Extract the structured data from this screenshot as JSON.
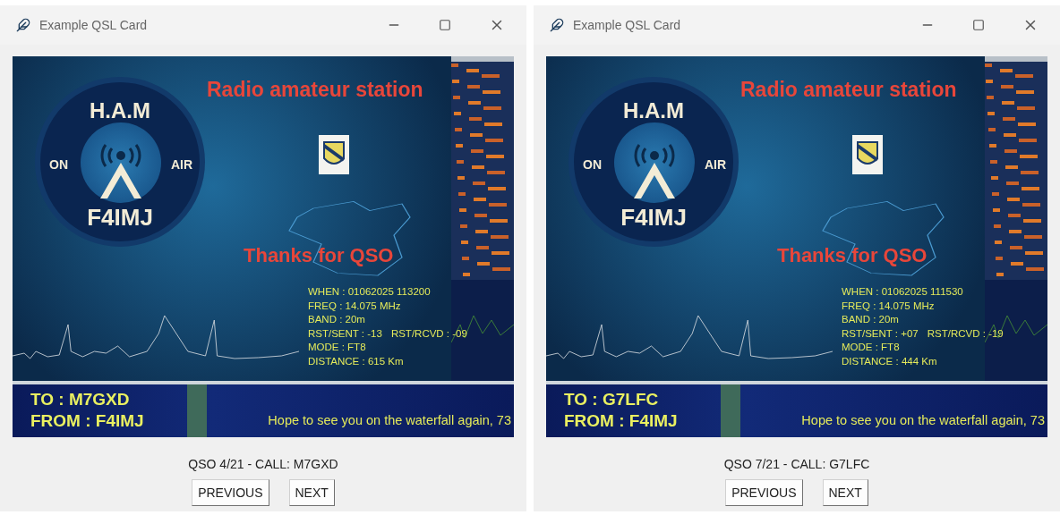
{
  "windows": [
    {
      "title": "Example QSL Card",
      "card": {
        "logo": {
          "top": "H.A.M",
          "left": "ON",
          "right": "AIR",
          "bottom": "F4IMJ"
        },
        "heading": "Radio amateur station",
        "thanks": "Thanks for QSO",
        "details": [
          [
            "WHEN : 01062025 113200"
          ],
          [
            "FREQ : 14.075 MHz"
          ],
          [
            "BAND : 20m"
          ],
          [
            "RST/SENT : -13",
            "RST/RCVD : -09"
          ],
          [
            "MODE : FT8"
          ],
          [
            "DISTANCE : 615 Km"
          ]
        ],
        "to": "TO : M7GXD",
        "from": "FROM : F4IMJ",
        "message": "Hope to see you on the waterfall again, 73"
      },
      "status": "QSO 4/21 - CALL: M7GXD",
      "buttons": [
        "PREVIOUS",
        "NEXT"
      ]
    },
    {
      "title": "Example QSL Card",
      "card": {
        "logo": {
          "top": "H.A.M",
          "left": "ON",
          "right": "AIR",
          "bottom": "F4IMJ"
        },
        "heading": "Radio amateur station",
        "thanks": "Thanks for QSO",
        "details": [
          [
            "WHEN : 01062025 111530"
          ],
          [
            "FREQ : 14.075 MHz"
          ],
          [
            "BAND : 20m"
          ],
          [
            "RST/SENT : +07",
            "RST/RCVD : -19"
          ],
          [
            "MODE : FT8"
          ],
          [
            "DISTANCE : 444 Km"
          ]
        ],
        "to": "TO : G7LFC",
        "from": "FROM : F4IMJ",
        "message": "Hope to see you on the waterfall again, 73"
      },
      "status": "QSO 7/21 - CALL: G7LFC",
      "buttons": [
        "PREVIOUS",
        "NEXT"
      ]
    }
  ]
}
